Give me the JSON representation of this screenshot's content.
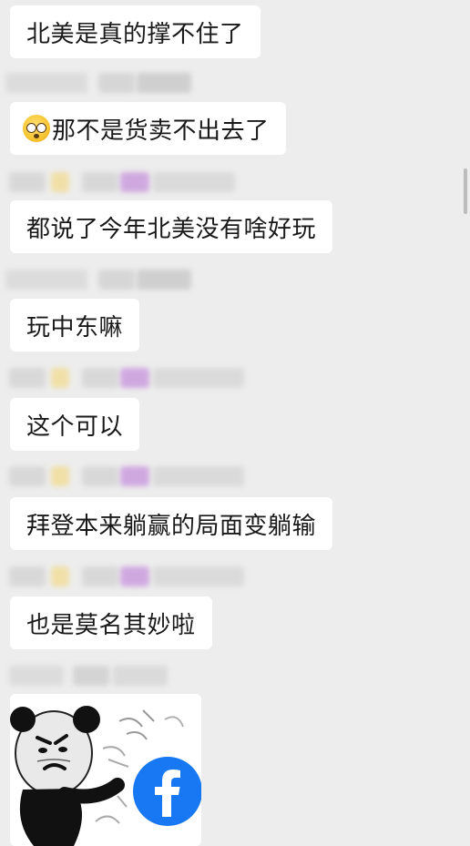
{
  "messages": [
    {
      "text": "北美是真的撑不住了"
    },
    {
      "text": "那不是货卖不出去了",
      "emoji": "astonished-face-emoji"
    },
    {
      "text": "都说了今年北美没有啥好玩"
    },
    {
      "text": "玩中东嘛"
    },
    {
      "text": "这个可以"
    },
    {
      "text": "拜登本来躺赢的局面变躺输"
    },
    {
      "text": "也是莫名其妙啦"
    }
  ],
  "sticker": {
    "description_icon": "panda-meme-sticker",
    "logo_icon": "facebook-logo-icon",
    "logo_color": "#1877f2"
  },
  "colors": {
    "background": "#ededed",
    "bubble": "#ffffff",
    "text": "#191919"
  }
}
